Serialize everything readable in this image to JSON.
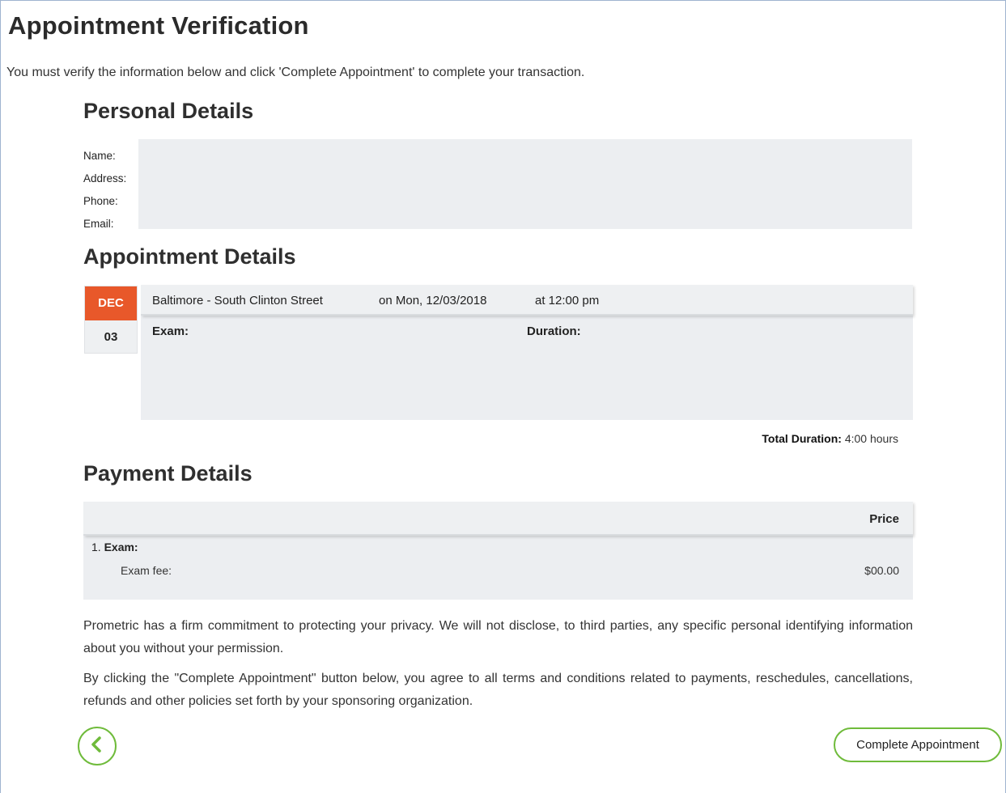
{
  "page": {
    "title": "Appointment Verification",
    "instructions": "You must verify the information below and click 'Complete Appointment' to complete your transaction."
  },
  "personal": {
    "heading": "Personal Details",
    "labels": [
      "Name:",
      "Address:",
      "Phone:",
      "Email:"
    ]
  },
  "appointment": {
    "heading": "Appointment Details",
    "month": "DEC",
    "day": "03",
    "location": "Baltimore - South Clinton Street",
    "date_text": "on Mon, 12/03/2018",
    "time_text": "at 12:00 pm",
    "exam_label": "Exam:",
    "duration_label": "Duration:",
    "total_duration_label": "Total Duration:",
    "total_duration_value": "4:00 hours"
  },
  "payment": {
    "heading": "Payment Details",
    "price_header": "Price",
    "item_number": "1.",
    "item_label": "Exam:",
    "fee_label": "Exam fee:",
    "fee_amount": "$00.00"
  },
  "legal": {
    "privacy": "Prometric has a firm commitment to protecting your privacy. We will not disclose, to third parties, any specific personal identifying information about you without your permission.",
    "terms": "By clicking the \"Complete Appointment\" button below, you agree to all terms and conditions related to payments, reschedules, cancellations, refunds and other policies set forth by your sponsoring organization."
  },
  "actions": {
    "back_icon": "chevron-left-icon",
    "complete_label": "Complete Appointment"
  },
  "colors": {
    "accent_green": "#6fbb3b",
    "month_orange": "#e8582a",
    "panel_gray": "#eceef1"
  }
}
